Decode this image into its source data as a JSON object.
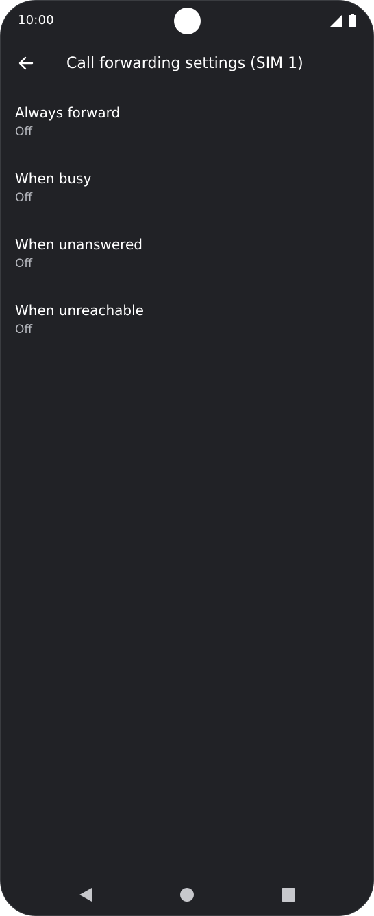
{
  "status_bar": {
    "time": "10:00",
    "icons": [
      "signal-icon",
      "battery-icon"
    ]
  },
  "app_bar": {
    "back_icon": "arrow-back-icon",
    "title": "Call forwarding settings (SIM 1)"
  },
  "settings": {
    "items": [
      {
        "title": "Always forward",
        "summary": "Off"
      },
      {
        "title": "When busy",
        "summary": "Off"
      },
      {
        "title": "When unanswered",
        "summary": "Off"
      },
      {
        "title": "When unreachable",
        "summary": "Off"
      }
    ]
  },
  "nav_bar": {
    "icons": [
      "nav-back-icon",
      "nav-home-icon",
      "nav-recents-icon"
    ]
  },
  "colors": {
    "background": "#212226",
    "primary_text": "#ffffff",
    "secondary_text": "#b7b9bf",
    "nav_icon": "#c7c8cc"
  }
}
